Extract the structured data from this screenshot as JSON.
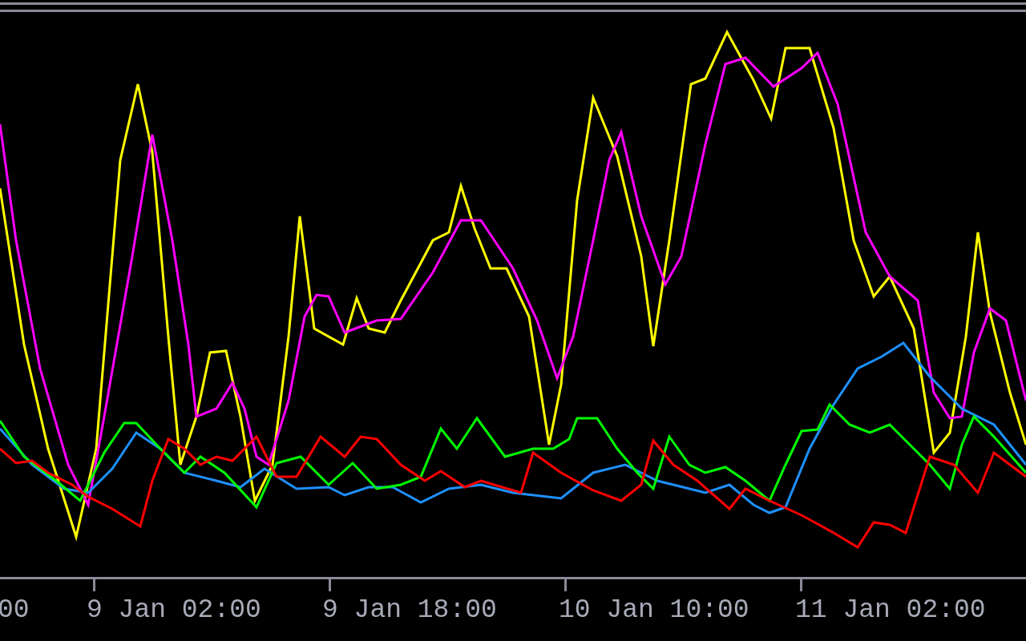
{
  "x_axis": {
    "labels": [
      "00",
      "9 Jan 02:00",
      "9 Jan 18:00",
      "10 Jan 10:00",
      "11 Jan 02:00"
    ]
  }
}
